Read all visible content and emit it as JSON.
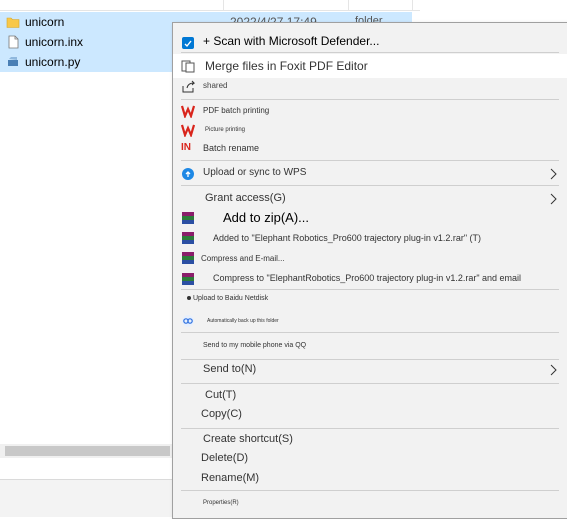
{
  "files": [
    {
      "name": "unicorn",
      "date": "2022/4/27 17:49",
      "type": "folder",
      "icon": "folder-icon",
      "selected": true
    },
    {
      "name": "unicorn.inx",
      "date": "",
      "type": "",
      "icon": "file-icon",
      "selected": true
    },
    {
      "name": "unicorn.py",
      "date": "",
      "type": "",
      "icon": "python-file-icon",
      "selected": true
    }
  ],
  "menu": {
    "scan_defender": "+ Scan with Microsoft Defender...",
    "merge_foxit": "Merge files in Foxit PDF Editor",
    "shared": "shared",
    "pdf_batch_printing": "PDF batch printing",
    "picture_printing": "Picture printing",
    "batch_rename": "Batch rename",
    "upload_wps": "Upload or sync to WPS",
    "grant_access": "Grant access(G)",
    "add_to_zip": "Add to zip(A)...",
    "added_to_rar": "Added to \"Elephant Robotics_Pro600 trajectory plug-in v1.2.rar\" (T)",
    "compress_email": "Compress and E-mail...",
    "compress_to_rar_email": "Compress to \"ElephantRobotics_Pro600 trajectory plug-in v1.2.rar\" and email",
    "upload_baidu": "Upload to Baidu Netdisk",
    "auto_backup": "Automatically back up this folder",
    "send_to_phone_qq": "Send to my mobile phone via QQ",
    "send_to": "Send to(N)",
    "cut": "Cut(T)",
    "copy": "Copy(C)",
    "create_shortcut": "Create shortcut(S)",
    "delete": "Delete(D)",
    "rename": "Rename(M)",
    "properties": "Properties(R)"
  },
  "colors": {
    "selection": "#cce8ff",
    "wps_red": "#d9251c",
    "defender_blue": "#0078d4",
    "folder_yellow": "#f8c84a"
  }
}
